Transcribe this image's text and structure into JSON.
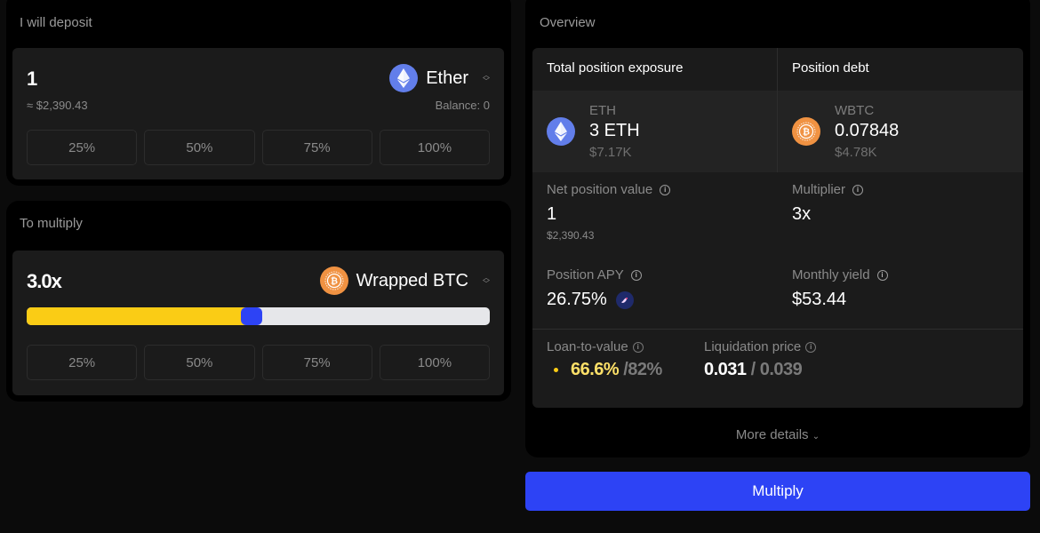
{
  "deposit": {
    "title": "I will deposit",
    "amount": "1",
    "usd_approx": "≈ $2,390.43",
    "token": {
      "name": "Ether",
      "icon": "eth-icon",
      "color": "#627eea"
    },
    "balance": "Balance: 0",
    "percent_buttons": [
      "25%",
      "50%",
      "75%",
      "100%"
    ]
  },
  "multiply": {
    "title": "To multiply",
    "multiplier": "3.0x",
    "token": {
      "name": "Wrapped BTC",
      "icon": "btc-icon",
      "color": "#f09242"
    },
    "slider_fraction": 0.485,
    "percent_buttons": [
      "25%",
      "50%",
      "75%",
      "100%"
    ]
  },
  "overview": {
    "title": "Overview",
    "exposure_header": "Total position exposure",
    "debt_header": "Position debt",
    "exposure": {
      "symbol": "ETH",
      "amount": "3 ETH",
      "usd": "$7.17K",
      "icon": "eth-icon"
    },
    "debt": {
      "symbol": "WBTC",
      "amount": "0.07848",
      "usd": "$4.78K",
      "icon": "btc-icon"
    },
    "net_position": {
      "label": "Net position value",
      "value": "1",
      "sub": "$2,390.43"
    },
    "multiplier": {
      "label": "Multiplier",
      "value": "3x"
    },
    "apy": {
      "label": "Position APY",
      "value": "26.75%"
    },
    "monthly_yield": {
      "label": "Monthly yield",
      "value": "$53.44"
    },
    "ltv": {
      "label": "Loan-to-value",
      "current": "66.6%",
      "max": "/82%"
    },
    "liquidation": {
      "label": "Liquidation price",
      "current": "0.031",
      "separator": " / ",
      "threshold": "0.039"
    },
    "more_details": "More details"
  },
  "actions": {
    "multiply_label": "Multiply"
  },
  "colors": {
    "accent": "#2d43f5",
    "slider_fill": "#facc15",
    "ltv_yellow": "#fde068"
  }
}
